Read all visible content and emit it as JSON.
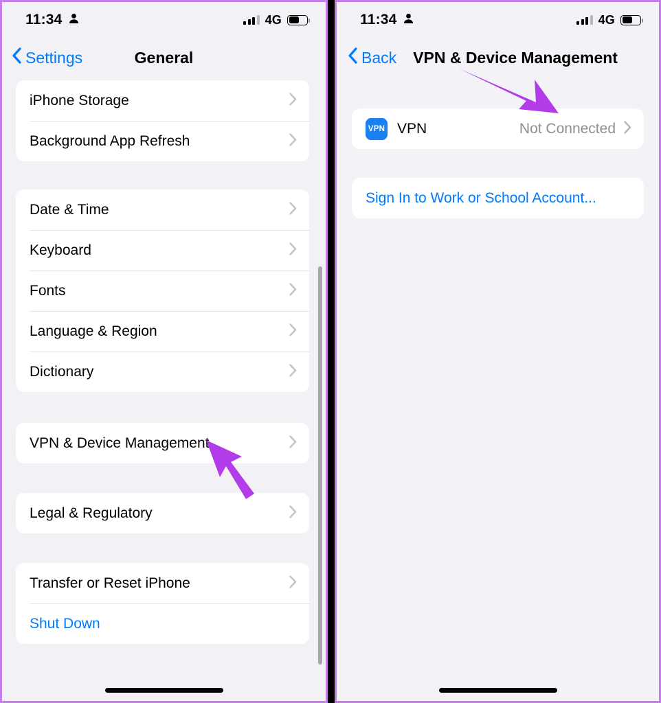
{
  "accent": {
    "ios_blue": "#007aff",
    "annotation_purple": "#b23ce8",
    "frame_purple": "#c77ee8",
    "vpn_icon_blue": "#1b80f2",
    "secondary_text": "#8e8e93"
  },
  "status_bar": {
    "time": "11:34",
    "person_icon": "person-icon",
    "signal_icon": "cellular-bars-icon",
    "network": "4G",
    "battery_icon": "battery-icon"
  },
  "left_screen": {
    "nav": {
      "back_icon": "chevron-left-icon",
      "back_label": "Settings",
      "title": "General"
    },
    "groups": [
      {
        "rows": [
          {
            "label": "iPhone Storage",
            "accessory": "chevron-right-icon"
          },
          {
            "label": "Background App Refresh",
            "accessory": "chevron-right-icon"
          }
        ]
      },
      {
        "rows": [
          {
            "label": "Date & Time",
            "accessory": "chevron-right-icon"
          },
          {
            "label": "Keyboard",
            "accessory": "chevron-right-icon"
          },
          {
            "label": "Fonts",
            "accessory": "chevron-right-icon"
          },
          {
            "label": "Language & Region",
            "accessory": "chevron-right-icon"
          },
          {
            "label": "Dictionary",
            "accessory": "chevron-right-icon"
          }
        ]
      },
      {
        "rows": [
          {
            "label": "VPN & Device Management",
            "accessory": "chevron-right-icon"
          }
        ]
      },
      {
        "rows": [
          {
            "label": "Legal & Regulatory",
            "accessory": "chevron-right-icon"
          }
        ]
      },
      {
        "rows": [
          {
            "label": "Transfer or Reset iPhone",
            "accessory": "chevron-right-icon"
          },
          {
            "label": "Shut Down",
            "accessory": "none",
            "style": "blue"
          }
        ]
      }
    ],
    "annotation": "arrow pointing to VPN & Device Management"
  },
  "right_screen": {
    "nav": {
      "back_icon": "chevron-left-icon",
      "back_label": "Back",
      "title": "VPN & Device Management"
    },
    "groups": [
      {
        "rows": [
          {
            "icon": "vpn-app-icon",
            "icon_text": "VPN",
            "label": "VPN",
            "value": "Not Connected",
            "accessory": "chevron-right-icon"
          }
        ]
      },
      {
        "rows": [
          {
            "label": "Sign In to Work or School Account...",
            "accessory": "none",
            "style": "blue"
          }
        ]
      }
    ],
    "annotation": "arrow pointing to VPN Not Connected row"
  }
}
